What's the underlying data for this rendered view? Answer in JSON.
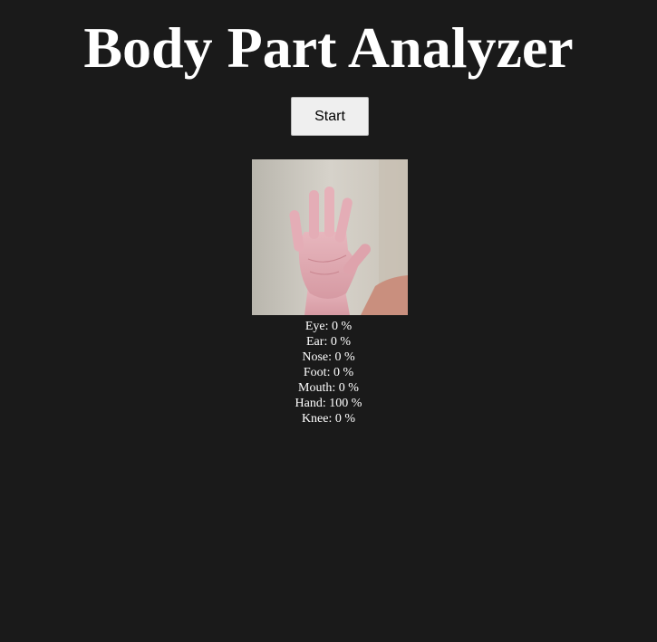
{
  "title": "Body Part Analyzer",
  "start_button_label": "Start",
  "colors": {
    "background": "#1a1a1a",
    "text": "#ffffff",
    "button_bg": "#efefef"
  },
  "webcam": {
    "icon": "webcam-hand-image"
  },
  "results": [
    {
      "label": "Eye",
      "value": "0",
      "unit": "%"
    },
    {
      "label": "Ear",
      "value": "0",
      "unit": "%"
    },
    {
      "label": "Nose",
      "value": "0",
      "unit": "%"
    },
    {
      "label": "Foot",
      "value": "0",
      "unit": "%"
    },
    {
      "label": "Mouth",
      "value": "0",
      "unit": "%"
    },
    {
      "label": "Hand",
      "value": "100",
      "unit": "%"
    },
    {
      "label": "Knee",
      "value": "0",
      "unit": "%"
    }
  ]
}
